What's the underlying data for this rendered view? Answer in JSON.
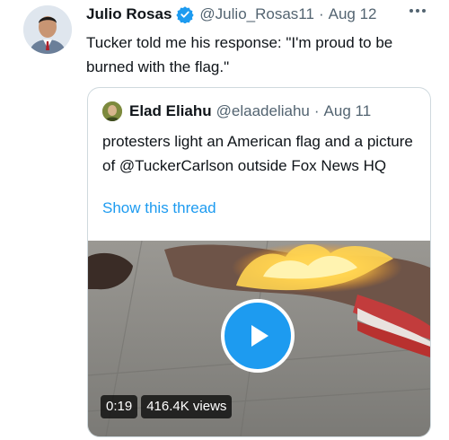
{
  "tweet": {
    "author_name": "Julio Rosas",
    "author_handle": "@Julio_Rosas11",
    "separator": "·",
    "date": "Aug 12",
    "text": "Tucker told me his response: \"I'm proud to be burned with the flag.\"",
    "verified_icon": "verified-badge-icon",
    "more_icon": "more-options-icon"
  },
  "quote": {
    "author_name": "Elad Eliahu",
    "author_handle": "@elaadeliahu",
    "separator": "·",
    "date": "Aug 11",
    "text": "protesters light an American flag and a picture of @TuckerCarlson outside Fox News HQ",
    "show_thread": "Show this thread",
    "video": {
      "duration": "0:19",
      "views": "416.4K views",
      "play_icon": "play-icon"
    }
  },
  "colors": {
    "accent": "#1d9bf0",
    "text": "#0f1419",
    "secondary": "#536471",
    "border": "#cfd9de"
  }
}
